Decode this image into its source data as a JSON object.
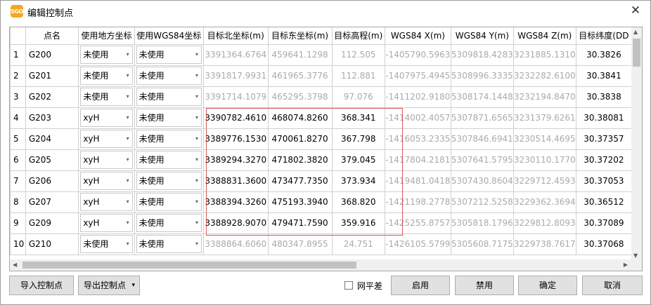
{
  "window": {
    "title": "编辑控制点",
    "icon_text": "SGO",
    "close": "✕"
  },
  "columns": [
    "",
    "点名",
    "使用地方坐标",
    "使用WGS84坐标",
    "目标北坐标(m)",
    "目标东坐标(m)",
    "目标高程(m)",
    "WGS84 X(m)",
    "WGS84 Y(m)",
    "WGS84 Z(m)",
    "目标纬度(DD"
  ],
  "rows": [
    {
      "n": "1",
      "name": "G200",
      "local": "未使用",
      "wgs": "未使用",
      "north": "3391364.6764",
      "east": "459641.1298",
      "h": "112.505",
      "x": "-1405790.5963",
      "y": "5309818.4283",
      "z": "3231885.1310",
      "lat": "30.3826"
    },
    {
      "n": "2",
      "name": "G201",
      "local": "未使用",
      "wgs": "未使用",
      "north": "3391817.9931",
      "east": "461965.3776",
      "h": "112.881",
      "x": "-1407975.4945",
      "y": "5308996.3335",
      "z": "3232282.6100",
      "lat": "30.3841"
    },
    {
      "n": "3",
      "name": "G202",
      "local": "未使用",
      "wgs": "未使用",
      "north": "3391714.1079",
      "east": "465295.3798",
      "h": "97.076",
      "x": "-1411202.9180",
      "y": "5308174.1448",
      "z": "3232194.8470",
      "lat": "30.3838"
    },
    {
      "n": "4",
      "name": "G203",
      "local": "xyH",
      "wgs": "未使用",
      "north": "3390782.4610",
      "east": "468074.8260",
      "h": "368.341",
      "x": "-1414002.4057",
      "y": "5307871.6565",
      "z": "3231379.6261",
      "lat": "30.38081"
    },
    {
      "n": "5",
      "name": "G204",
      "local": "xyH",
      "wgs": "未使用",
      "north": "3389776.1530",
      "east": "470061.8270",
      "h": "367.798",
      "x": "-1416053.2335",
      "y": "5307846.6941",
      "z": "3230514.4695",
      "lat": "30.37357"
    },
    {
      "n": "6",
      "name": "G205",
      "local": "xyH",
      "wgs": "未使用",
      "north": "3389294.3270",
      "east": "471802.3820",
      "h": "379.045",
      "x": "-1417804.2181",
      "y": "5307641.5795",
      "z": "3230110.1770",
      "lat": "30.37202"
    },
    {
      "n": "7",
      "name": "G206",
      "local": "xyH",
      "wgs": "未使用",
      "north": "3388831.3600",
      "east": "473477.7350",
      "h": "373.934",
      "x": "-1419481.0418",
      "y": "5307430.8604",
      "z": "3229712.4593",
      "lat": "30.37053"
    },
    {
      "n": "8",
      "name": "G207",
      "local": "xyH",
      "wgs": "未使用",
      "north": "3388394.3260",
      "east": "475193.3940",
      "h": "368.820",
      "x": "-1421198.2778",
      "y": "5307212.5258",
      "z": "3229362.3694",
      "lat": "30.36512"
    },
    {
      "n": "9",
      "name": "G209",
      "local": "xyH",
      "wgs": "未使用",
      "north": "3388928.9070",
      "east": "479471.7590",
      "h": "359.916",
      "x": "-1425255.8757",
      "y": "5305818.1796",
      "z": "3229812.8093",
      "lat": "30.37089"
    },
    {
      "n": "10",
      "name": "G210",
      "local": "未使用",
      "wgs": "未使用",
      "north": "3388864.6060",
      "east": "480347.8955",
      "h": "24.751",
      "x": "-1426105.5799",
      "y": "5305608.7175",
      "z": "3229738.7617",
      "lat": "30.37068"
    }
  ],
  "buttons": {
    "import": "导入控制点",
    "export": "导出控制点",
    "export_arrow": "▾",
    "net_flat": "网平差",
    "enable": "启用",
    "disable": "禁用",
    "ok": "确定",
    "cancel": "取消"
  }
}
